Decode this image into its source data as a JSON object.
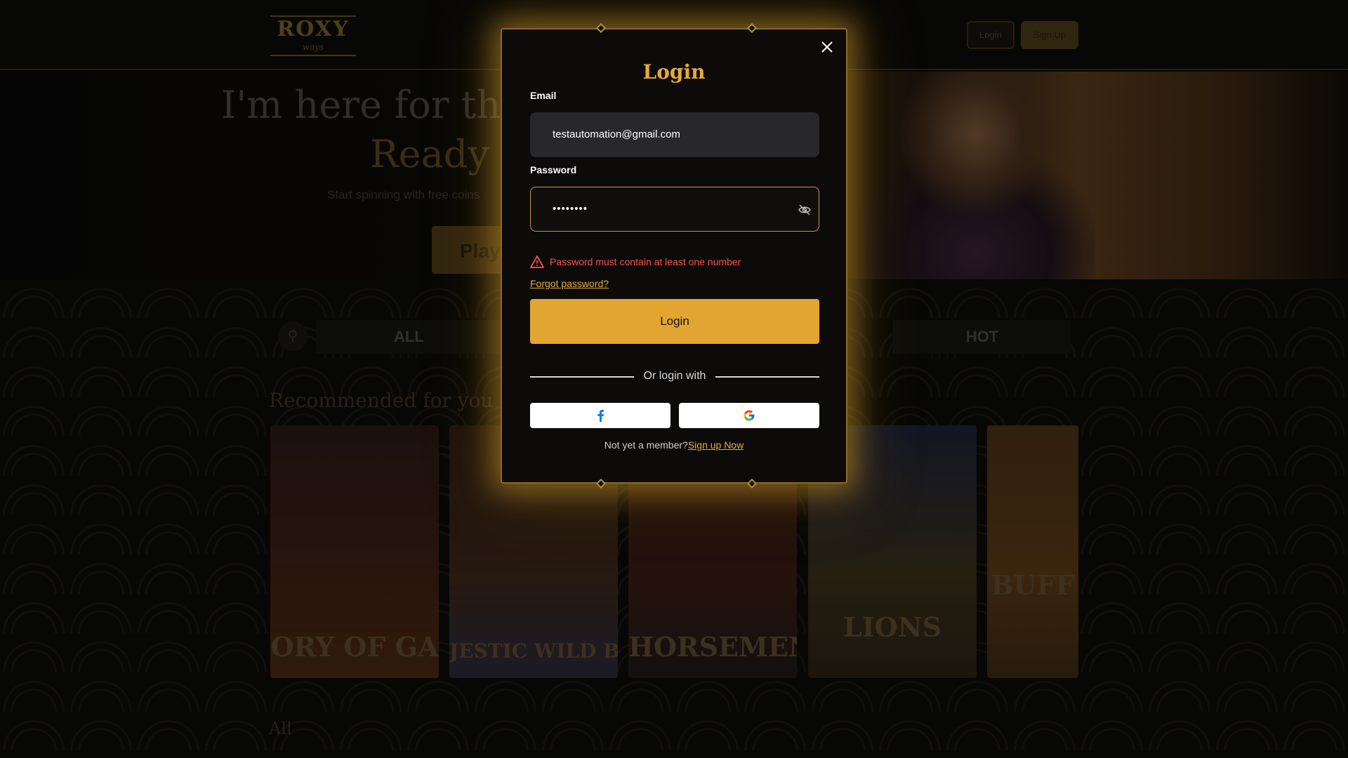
{
  "topbar": {
    "logo_main": "ROXY",
    "logo_sub": "ways",
    "login_label": "Login",
    "signup_label": "Sign Up"
  },
  "hero": {
    "line1": "I'm here for the",
    "line2": "Ready t",
    "subtitle": "Start spinning with free coins",
    "play_label": "Play"
  },
  "lobby": {
    "category_all": "ALL",
    "category_hot": "HOT",
    "recommended_title": "Recommended for you",
    "all_title": "All",
    "games": [
      {
        "title": "ORY OF GA"
      },
      {
        "title": "JESTIC WILD BUFFA"
      },
      {
        "title": "HORSEMEN"
      },
      {
        "title": "LIONS"
      },
      {
        "title": "BUFF"
      }
    ]
  },
  "modal": {
    "title": "Login",
    "email_label": "Email",
    "email_value": "testautomation@gmail.com",
    "password_label": "Password",
    "password_value": "••••••••",
    "error_message": "Password must contain at least one number",
    "forgot_password": "Forgot password?",
    "login_button": "Login",
    "divider_text": "Or login with",
    "signup_prompt": "Not yet a member?",
    "signup_link": "Sign up Now"
  },
  "colors": {
    "accent": "#e2a532",
    "error": "#ff4d4d",
    "modal_border": "#8a6a24"
  },
  "icons": {
    "close": "close-icon",
    "eye": "eye-slash-icon",
    "warning": "warning-icon",
    "facebook": "facebook-icon",
    "google": "google-icon",
    "search": "search-icon"
  }
}
